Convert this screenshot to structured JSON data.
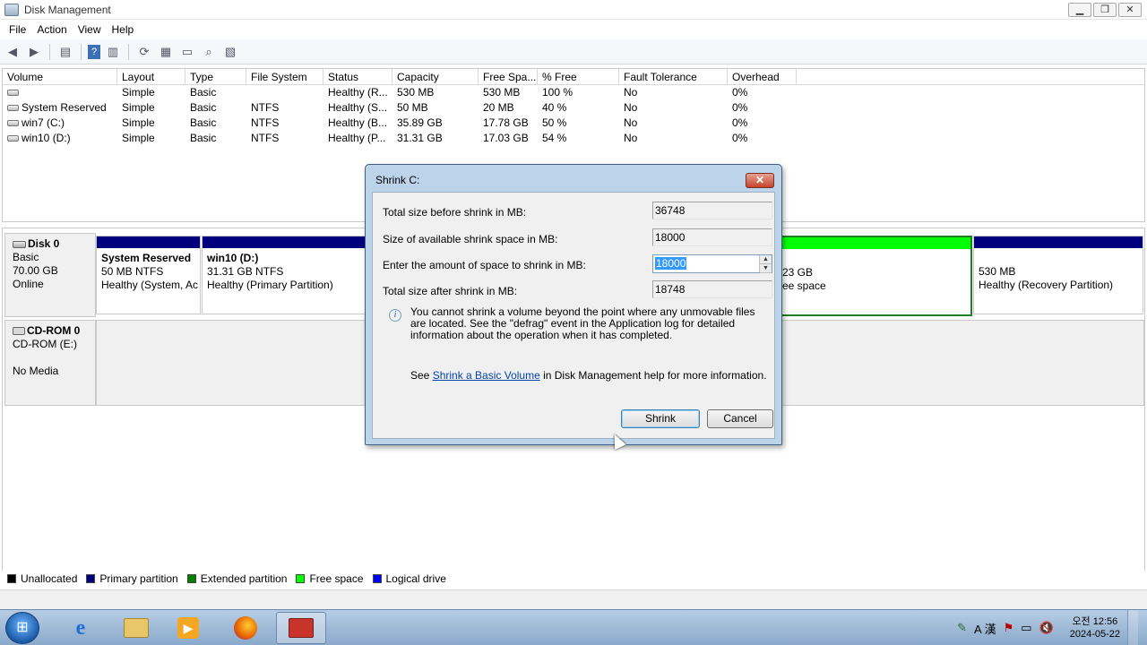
{
  "window": {
    "title": "Disk Management",
    "minimize": "▁",
    "restore": "❐",
    "close": "✕"
  },
  "menu": [
    "File",
    "Action",
    "View",
    "Help"
  ],
  "volume_list": {
    "headers": [
      "Volume",
      "Layout",
      "Type",
      "File System",
      "Status",
      "Capacity",
      "Free Spa...",
      "% Free",
      "Fault Tolerance",
      "Overhead"
    ],
    "rows": [
      [
        "",
        "Simple",
        "Basic",
        "",
        "Healthy (R...",
        "530 MB",
        "530 MB",
        "100 %",
        "No",
        "0%"
      ],
      [
        "System Reserved",
        "Simple",
        "Basic",
        "NTFS",
        "Healthy (S...",
        "50 MB",
        "20 MB",
        "40 %",
        "No",
        "0%"
      ],
      [
        "win7 (C:)",
        "Simple",
        "Basic",
        "NTFS",
        "Healthy (B...",
        "35.89 GB",
        "17.78 GB",
        "50 %",
        "No",
        "0%"
      ],
      [
        "win10 (D:)",
        "Simple",
        "Basic",
        "NTFS",
        "Healthy (P...",
        "31.31 GB",
        "17.03 GB",
        "54 %",
        "No",
        "0%"
      ]
    ]
  },
  "disks": {
    "disk0": {
      "name": "Disk 0",
      "type": "Basic",
      "size": "70.00 GB",
      "state": "Online"
    },
    "cdrom0": {
      "name": "CD-ROM 0",
      "drive": "CD-ROM (E:)",
      "media": "No Media"
    }
  },
  "partitions": {
    "system_reserved": {
      "name": "System Reserved",
      "size": "50 MB NTFS",
      "status": "Healthy (System, Ac"
    },
    "win10": {
      "name": "win10  (D:)",
      "size": "31.31 GB NTFS",
      "status": "Healthy (Primary Partition)"
    },
    "free": {
      "size": "23 GB",
      "status": "ee space"
    },
    "recovery": {
      "size": "530 MB",
      "status": "Healthy (Recovery Partition)"
    }
  },
  "legend": [
    {
      "label": "Unallocated",
      "color": "#000000"
    },
    {
      "label": "Primary partition",
      "color": "#00007f"
    },
    {
      "label": "Extended partition",
      "color": "#008000"
    },
    {
      "label": "Free space",
      "color": "#00ff00"
    },
    {
      "label": "Logical drive",
      "color": "#0000ff"
    }
  ],
  "dialog": {
    "title": "Shrink C:",
    "close": "✕",
    "total_before_label": "Total size before shrink in MB:",
    "total_before_value": "36748",
    "available_label": "Size of available shrink space in MB:",
    "available_value": "18000",
    "amount_label": "Enter the amount of space to shrink in MB:",
    "amount_value": "18000",
    "total_after_label": "Total size after shrink in MB:",
    "total_after_value": "18748",
    "info": "You cannot shrink a volume beyond the point where any unmovable files are located. See the \"defrag\" event in the Application log for detailed information about the operation when it has completed.",
    "help_prefix": "See ",
    "help_link": "Shrink a Basic Volume",
    "help_suffix": " in Disk Management help for more information.",
    "shrink_button": "Shrink",
    "cancel_button": "Cancel"
  },
  "taskbar": {
    "tray_text": "A 漢",
    "clock_time": "오전 12:56",
    "clock_date": "2024-05-22"
  }
}
